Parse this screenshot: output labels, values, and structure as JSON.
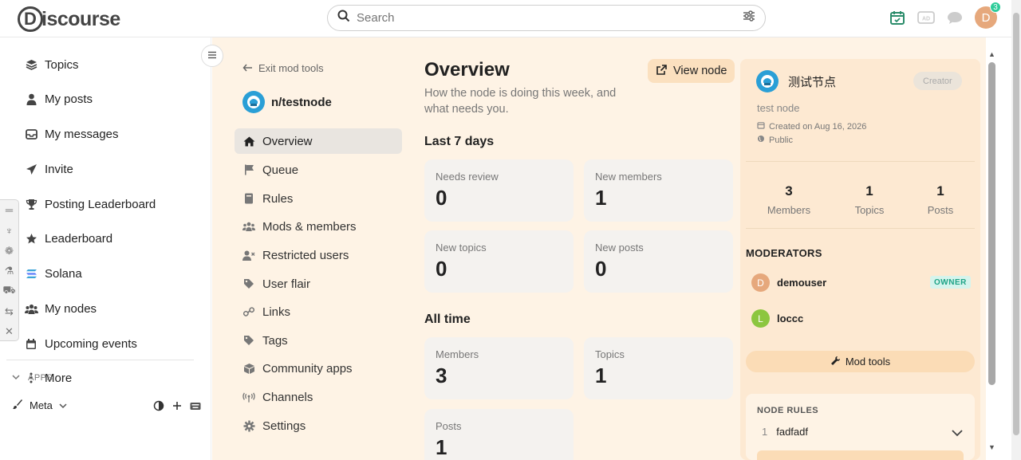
{
  "header": {
    "logo_text": "iscourse",
    "logo_letter": "D",
    "search_placeholder": "Search",
    "avatar_letter": "D",
    "notification_count": "3"
  },
  "sidebar": {
    "items": [
      {
        "label": "Topics",
        "icon": "layers-icon"
      },
      {
        "label": "My posts",
        "icon": "user-icon"
      },
      {
        "label": "My messages",
        "icon": "inbox-icon"
      },
      {
        "label": "Invite",
        "icon": "paper-plane-icon"
      },
      {
        "label": "Posting Leaderboard",
        "icon": "trophy-icon"
      },
      {
        "label": "Leaderboard",
        "icon": "star-icon"
      },
      {
        "label": "Solana",
        "icon": "solana-icon"
      },
      {
        "label": "My nodes",
        "icon": "users-icon"
      },
      {
        "label": "Upcoming events",
        "icon": "calendar-icon"
      },
      {
        "label": "More",
        "icon": "ellipsis-vertical-icon"
      }
    ],
    "apps_label": "APPS",
    "meta_label": "Meta"
  },
  "modnav": {
    "exit_label": "Exit mod tools",
    "node_name": "n/testnode",
    "items": [
      {
        "label": "Overview",
        "active": true
      },
      {
        "label": "Queue"
      },
      {
        "label": "Rules"
      },
      {
        "label": "Mods & members"
      },
      {
        "label": "Restricted users"
      },
      {
        "label": "User flair"
      },
      {
        "label": "Links"
      },
      {
        "label": "Tags"
      },
      {
        "label": "Community apps"
      },
      {
        "label": "Channels"
      },
      {
        "label": "Settings"
      }
    ]
  },
  "overview": {
    "title": "Overview",
    "subtitle": "How the node is doing this week, and what needs you.",
    "view_node_label": "View node",
    "last7_title": "Last 7 days",
    "last7": [
      {
        "label": "Needs review",
        "value": "0"
      },
      {
        "label": "New members",
        "value": "1"
      },
      {
        "label": "New topics",
        "value": "0"
      },
      {
        "label": "New posts",
        "value": "0"
      }
    ],
    "alltime_title": "All time",
    "alltime": [
      {
        "label": "Members",
        "value": "3"
      },
      {
        "label": "Topics",
        "value": "1"
      },
      {
        "label": "Posts",
        "value": "1"
      }
    ]
  },
  "node_panel": {
    "name": "测试节点",
    "role_badge": "Creator",
    "description": "test node",
    "created": "Created on Aug 16, 2026",
    "visibility": "Public",
    "stats": [
      {
        "value": "3",
        "label": "Members"
      },
      {
        "value": "1",
        "label": "Topics"
      },
      {
        "value": "1",
        "label": "Posts"
      }
    ],
    "moderators_title": "MODERATORS",
    "moderators": [
      {
        "name": "demouser",
        "initial": "D",
        "color": "#e6a87c",
        "badge": "OWNER"
      },
      {
        "name": "loccc",
        "initial": "L",
        "color": "#8cc63f",
        "badge": ""
      }
    ],
    "mod_tools_label": "Mod tools",
    "rules_title": "NODE RULES",
    "rules": [
      {
        "num": "1",
        "text": "fadfadf"
      }
    ]
  },
  "colors": {
    "main_bg": "#fef3e5",
    "panel_bg": "#fde9d2",
    "accent_btn": "#fbdcb6",
    "owner_green": "#1ea386",
    "calendar_green": "#2a8c6a"
  }
}
